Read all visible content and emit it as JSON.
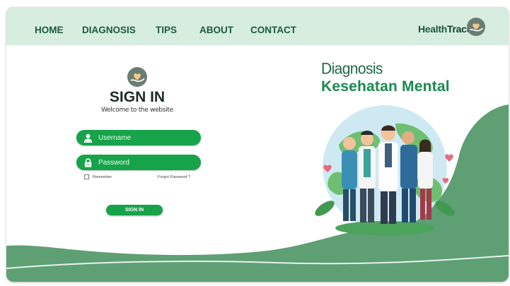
{
  "nav": {
    "items": [
      "HOME",
      "DIAGNOSIS",
      "TIPS",
      "ABOUT",
      "CONTACT"
    ],
    "brand_part1": "Health",
    "brand_part2": "Trace"
  },
  "login": {
    "title": "SIGN IN",
    "subtitle": "Welcome to the website",
    "username_placeholder": "Username",
    "password_placeholder": "Password",
    "remember_label": "Remember",
    "forgot_label": "Forgot Password ?",
    "submit_label": "SIGN IN"
  },
  "hero": {
    "line1": "Diagnosis",
    "line2": "Kesehatan Mental"
  },
  "colors": {
    "accent": "#17a34a",
    "nav_bg": "#d6ede0",
    "wave": "#5e9f74",
    "text_dark": "#1d5a3d"
  },
  "icons": {
    "logo": "heart-in-hand-icon",
    "username": "user-icon",
    "password": "lock-icon"
  }
}
